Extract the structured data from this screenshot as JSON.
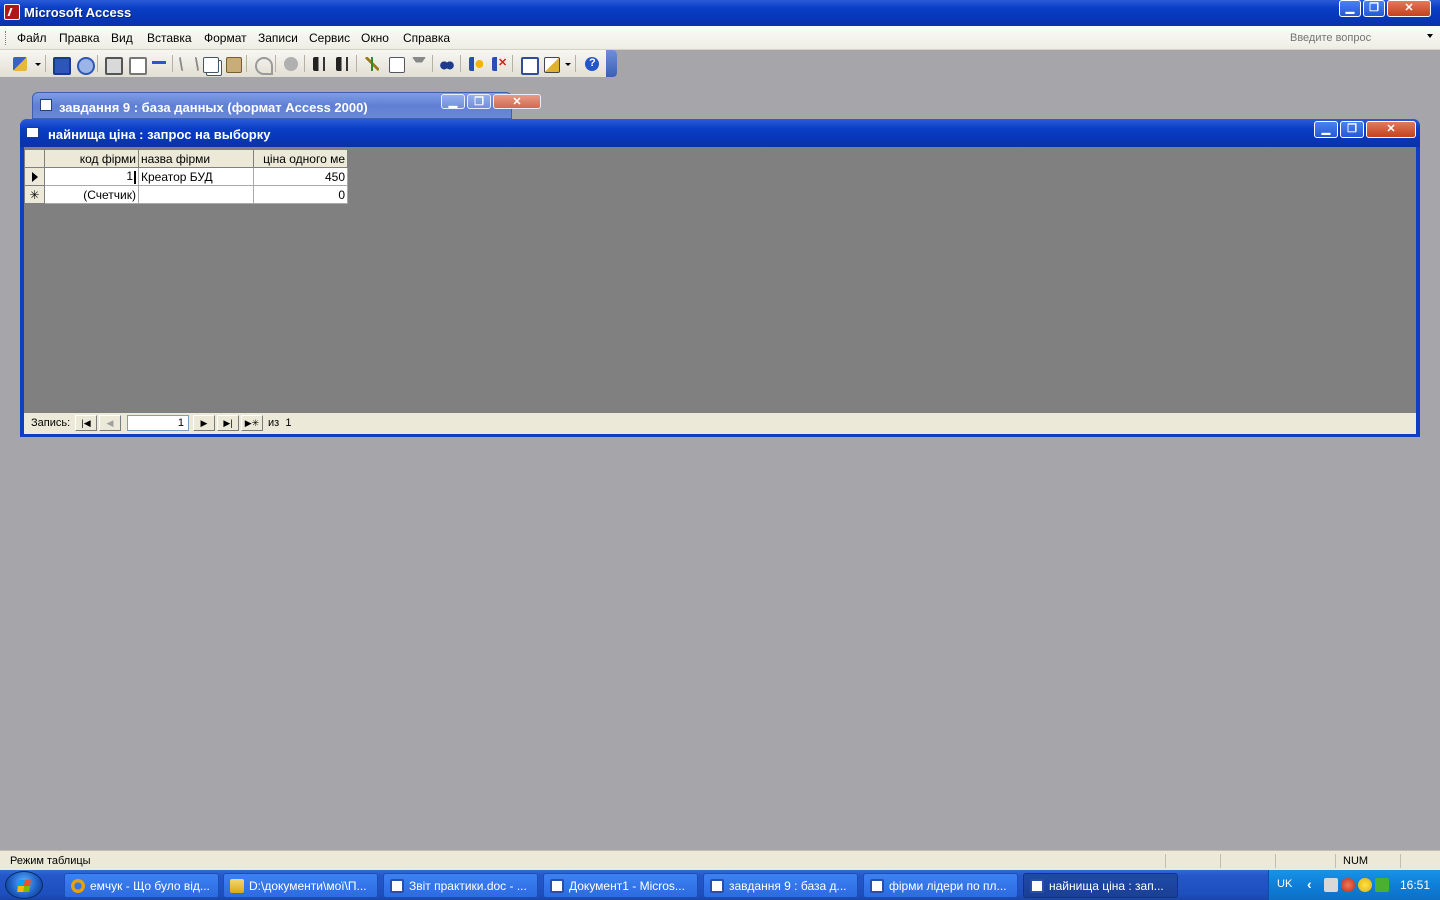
{
  "app": {
    "title": "Microsoft Access"
  },
  "menu": {
    "items": [
      "Файл",
      "Правка",
      "Вид",
      "Вставка",
      "Формат",
      "Записи",
      "Сервис",
      "Окно",
      "Справка"
    ],
    "ask_placeholder": "Введите вопрос"
  },
  "toolbar": {
    "icons": [
      "design-view-icon",
      "save-icon",
      "search-file-icon",
      "print-icon",
      "print-preview-icon",
      "spelling-icon",
      "cut-icon",
      "copy-icon",
      "paste-icon",
      "undo-icon",
      "office-links-icon",
      "sort-ascending-icon",
      "sort-descending-icon",
      "filter-by-selection-icon",
      "filter-by-form-icon",
      "apply-filter-icon",
      "find-icon",
      "new-record-icon",
      "delete-record-icon",
      "database-window-icon",
      "new-object-icon",
      "help-icon"
    ]
  },
  "db_window": {
    "title": "завдання 9 : база данных (формат Access 2000)"
  },
  "query_window": {
    "title": "найнища ціна : запрос на выборку",
    "columns": [
      "код фірми",
      "назва фірми",
      "ціна одного ме"
    ],
    "rows": [
      {
        "id": "1",
        "name": "Креатор БУД",
        "price": "450"
      }
    ],
    "new_row": {
      "id": "(Счетчик)",
      "name": "",
      "price": "0"
    },
    "new_row_marker": "✳",
    "navigator": {
      "label": "Запись:",
      "current": "1",
      "of_label": "из",
      "total": "1"
    }
  },
  "statusbar": {
    "text": "Режим таблицы",
    "num": "NUM"
  },
  "taskbar": {
    "tasks": [
      {
        "label": "емчук - Що було від...",
        "icon": "opera"
      },
      {
        "label": "D:\\документи\\мої\\П...",
        "icon": "folder"
      },
      {
        "label": "Звіт практики.doc - ...",
        "icon": "word"
      },
      {
        "label": "Документ1 - Micros...",
        "icon": "word"
      },
      {
        "label": "завдання 9 : база д...",
        "icon": "access"
      },
      {
        "label": "фірми лідери по пл...",
        "icon": "access"
      },
      {
        "label": "найнища ціна : зап...",
        "icon": "access",
        "active": true
      }
    ],
    "tray": {
      "lang": "UK",
      "clock": "16:51"
    }
  },
  "colors": {
    "titlebar": "#0a3fc6",
    "workspace": "#a6a5aa",
    "datasheet_bg": "#808080",
    "taskbar": "#2457c9"
  }
}
